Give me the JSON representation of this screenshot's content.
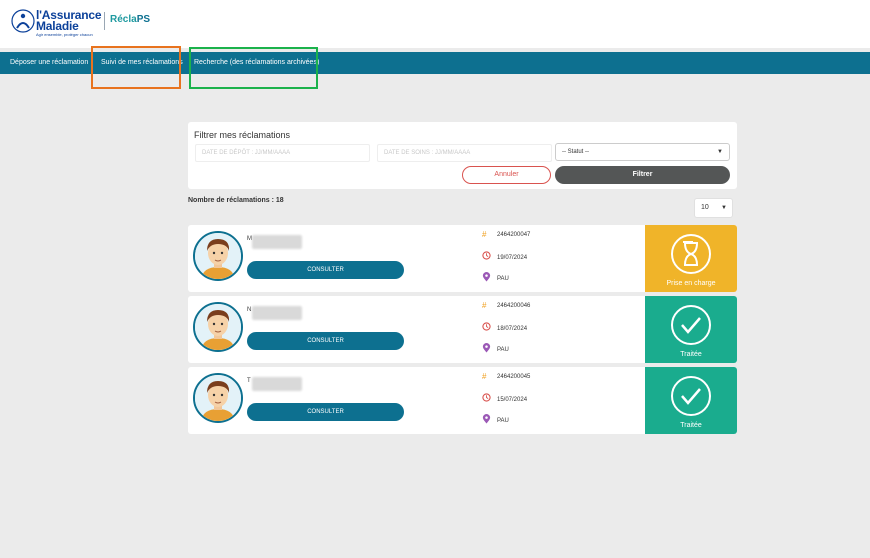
{
  "brand": {
    "line1": "l'Assurance",
    "line2": "Maladie",
    "tagline": "Agir ensemble, protéger chacun",
    "app_name_a": "Récla",
    "app_name_b": "PS",
    "primary_color": "#0d7090"
  },
  "nav": {
    "items": [
      "Déposer une réclamation",
      "Suivi de mes réclamations",
      "Recherche (des réclamations archivées)"
    ]
  },
  "filter": {
    "title": "Filtrer mes réclamations",
    "depot_placeholder": "DATE DE DÉPÔT : JJ/MM/AAAA",
    "soins_placeholder": "DATE DE SOINS : JJ/MM/AAAA",
    "status_selected": "-- Statut --",
    "cancel_label": "Annuler",
    "filter_label": "Filtrer"
  },
  "list": {
    "count_label": "Nombre de réclamations : 18",
    "per_page": "10"
  },
  "claims": [
    {
      "name": "M",
      "id": "2464200047",
      "date": "19/07/2024",
      "city": "PAU",
      "status": "Prise en charge",
      "status_color": "#f0b429",
      "status_icon": "hourglass-icon",
      "action": "CONSULTER"
    },
    {
      "name": "N",
      "id": "2464200046",
      "date": "18/07/2024",
      "city": "PAU",
      "status": "Traitée",
      "status_color": "#1aac8e",
      "status_icon": "check-circle-icon",
      "action": "CONSULTER"
    },
    {
      "name": "T",
      "id": "2464200045",
      "date": "15/07/2024",
      "city": "PAU",
      "status": "Traitée",
      "status_color": "#1aac8e",
      "status_icon": "check-circle-icon",
      "action": "CONSULTER"
    }
  ],
  "icon_colors": {
    "hash": "#f0a020",
    "clock": "#d9534f",
    "pin": "#9b59b6"
  }
}
